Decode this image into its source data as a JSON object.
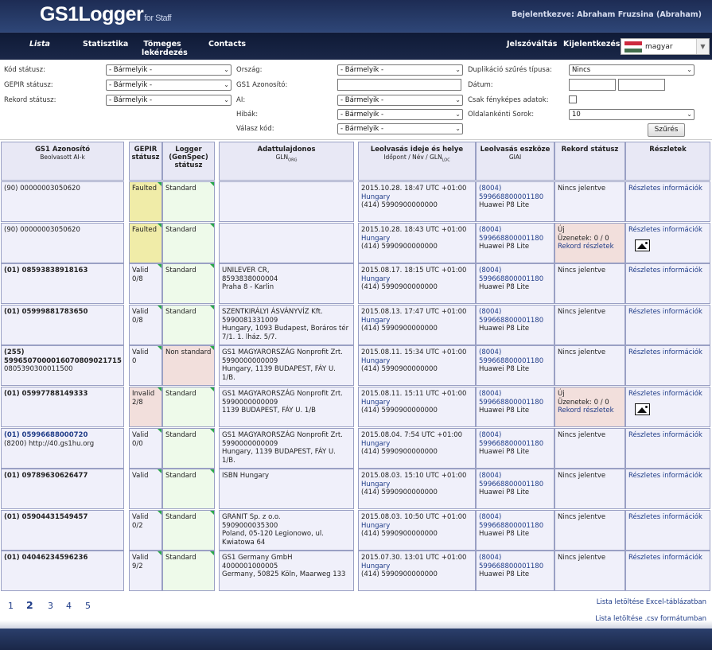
{
  "header": {
    "logo": "GS1Logger",
    "logo_sub": "for Staff",
    "login_info": "Bejelentkezve: Abraham Fruzsina (Abraham)"
  },
  "nav": {
    "lista": "Lista",
    "statisztika": "Statisztika",
    "tomeges": "Tömeges lekérdezés",
    "contacts": "Contacts",
    "jelszovaltas": "Jelszóváltás",
    "kijelentkezes": "Kijelentkezés",
    "language": "magyar"
  },
  "filters": {
    "kod_statusz_label": "Kód státusz:",
    "kod_statusz_value": "- Bármelyik -",
    "gepir_statusz_label": "GEPIR státusz:",
    "gepir_statusz_value": "- Bármelyik -",
    "rekord_statusz_label": "Rekord státusz:",
    "rekord_statusz_value": "- Bármelyik -",
    "orszag_label": "Ország:",
    "orszag_value": "- Bármelyik -",
    "gs1_azonosito_label": "GS1 Azonosító:",
    "ai_label": "AI:",
    "ai_value": "- Bármelyik -",
    "hibak_label": "Hibák:",
    "hibak_value": "- Bármelyik -",
    "valasz_kod_label": "Válasz kód:",
    "valasz_kod_value": "- Bármelyik -",
    "duplikacio_label": "Duplikáció szűrés típusa:",
    "duplikacio_value": "Nincs",
    "datum_label": "Dátum:",
    "csak_fenykepes_label": "Csak fényképes adatok:",
    "oldalankenti_label": "Oldalankénti Sorok:",
    "oldalankenti_value": "10",
    "szures_button": "Szűrés"
  },
  "table": {
    "headers": {
      "gs1": "GS1 Azonosító",
      "gs1_sub": "Beolvasott AI-k",
      "gepir": "GEPIR státusz",
      "logger": "Logger (GenSpec) státusz",
      "owner": "Adattulajdonos",
      "owner_sub": "GLN",
      "owner_sub_sub": "ORG",
      "scan": "Leolvasás ideje és helye",
      "scan_sub": "Időpont / Név / GLN",
      "scan_sub_sub": "LOC",
      "device": "Leolvasás eszköze",
      "device_sub": "GIAI",
      "record": "Rekord státusz",
      "details": "Részletek"
    },
    "rows": [
      {
        "id": "(90) 00000003050620",
        "id_extra": "",
        "bold": false,
        "link": false,
        "gepir": "Faulted",
        "gepir_extra": "",
        "gepir_cls": "faulted",
        "logger": "Standard",
        "logger_cls": "standard",
        "owner": [
          "",
          "",
          ""
        ],
        "scan": [
          "2015.10.28. 18:47 UTC +01:00",
          "Hungary",
          "(414) 5990900000000"
        ],
        "device": [
          "(8004)",
          "599668800001180",
          "Huawei P8 Lite"
        ],
        "record": [
          "Nincs jelentve",
          "",
          ""
        ],
        "record_new": false,
        "details": "Részletes információk",
        "has_image": false
      },
      {
        "id": "(90) 00000003050620",
        "id_extra": "",
        "bold": false,
        "link": false,
        "gepir": "Faulted",
        "gepir_extra": "",
        "gepir_cls": "faulted",
        "logger": "Standard",
        "logger_cls": "standard",
        "owner": [
          "",
          "",
          ""
        ],
        "scan": [
          "2015.10.28. 18:43 UTC +01:00",
          "Hungary",
          "(414) 5990900000000"
        ],
        "device": [
          "(8004)",
          "599668800001180",
          "Huawei P8 Lite"
        ],
        "record": [
          "Új",
          "Üzenetek: 0 / 0",
          "Rekord részletek"
        ],
        "record_new": true,
        "details": "Részletes információk",
        "has_image": true
      },
      {
        "id": "(01) 08593838918163",
        "id_extra": "",
        "bold": true,
        "link": false,
        "gepir": "Valid",
        "gepir_extra": "0/8",
        "gepir_cls": "",
        "logger": "Standard",
        "logger_cls": "standard",
        "owner": [
          "UNILEVER CR,",
          "8593838000004",
          "Praha 8 - Karlin"
        ],
        "scan": [
          "2015.08.17. 18:15 UTC +01:00",
          "Hungary",
          "(414) 5990900000000"
        ],
        "device": [
          "(8004)",
          "599668800001180",
          "Huawei P8 Lite"
        ],
        "record": [
          "Nincs jelentve",
          "",
          ""
        ],
        "record_new": false,
        "details": "Részletes információk",
        "has_image": false
      },
      {
        "id": "(01) 05999881783650",
        "id_extra": "",
        "bold": true,
        "link": false,
        "gepir": "Valid",
        "gepir_extra": "0/8",
        "gepir_cls": "",
        "logger": "Standard",
        "logger_cls": "standard",
        "owner": [
          "SZENTKIRÁLYI ÁSVÁNYVÍZ Kft.",
          "5990081331009",
          "Hungary, 1093 Budapest, Boráros tér 7/1. 1. lház. 5/7."
        ],
        "scan": [
          "2015.08.13. 17:47 UTC +01:00",
          "Hungary",
          "(414) 5990900000000"
        ],
        "device": [
          "(8004)",
          "599668800001180",
          "Huawei P8 Lite"
        ],
        "record": [
          "Nincs jelentve",
          "",
          ""
        ],
        "record_new": false,
        "details": "Részletes információk",
        "has_image": false
      },
      {
        "id": "(255) 5996507000016070809021715",
        "id_extra": "0805390300011500",
        "bold": true,
        "link": false,
        "gepir": "Valid",
        "gepir_extra": "0",
        "gepir_cls": "",
        "logger": "Non standard",
        "logger_cls": "nonstd",
        "owner": [
          "GS1 MAGYARORSZÁG Nonprofit Zrt.",
          "5990000000009",
          "Hungary, 1139 BUDAPEST, FÁY U. 1/B."
        ],
        "scan": [
          "2015.08.11. 15:34 UTC +01:00",
          "Hungary",
          "(414) 5990900000000"
        ],
        "device": [
          "(8004)",
          "599668800001180",
          "Huawei P8 Lite"
        ],
        "record": [
          "Nincs jelentve",
          "",
          ""
        ],
        "record_new": false,
        "details": "Részletes információk",
        "has_image": false
      },
      {
        "id": "(01) 05997788149333",
        "id_extra": "",
        "bold": true,
        "link": false,
        "gepir": "Invalid",
        "gepir_extra": "2/8",
        "gepir_cls": "invalid",
        "logger": "Standard",
        "logger_cls": "standard",
        "owner": [
          "GS1 MAGYARORSZÁG Nonprofit Zrt.",
          "5990000000009",
          "1139 BUDAPEST, FÁY U. 1/B"
        ],
        "scan": [
          "2015.08.11. 15:11 UTC +01:00",
          "Hungary",
          "(414) 5990900000000"
        ],
        "device": [
          "(8004)",
          "599668800001180",
          "Huawei P8 Lite"
        ],
        "record": [
          "Új",
          "Üzenetek: 0 / 0",
          "Rekord részletek"
        ],
        "record_new": true,
        "details": "Részletes információk",
        "has_image": true
      },
      {
        "id": "(01) 05996688000720",
        "id_extra": "(8200) http://40.gs1hu.org",
        "bold": true,
        "link": true,
        "gepir": "Valid",
        "gepir_extra": "0/0",
        "gepir_cls": "",
        "logger": "Standard",
        "logger_cls": "standard",
        "owner": [
          "GS1 MAGYARORSZÁG Nonprofit Zrt.",
          "5990000000009",
          "Hungary, 1139 BUDAPEST, FÁY U. 1/B."
        ],
        "scan": [
          "2015.08.04. 7:54 UTC +01:00",
          "Hungary",
          "(414) 5990900000000"
        ],
        "device": [
          "(8004)",
          "599668800001180",
          "Huawei P8 Lite"
        ],
        "record": [
          "Nincs jelentve",
          "",
          ""
        ],
        "record_new": false,
        "details": "Részletes információk",
        "has_image": false
      },
      {
        "id": "(01) 09789630626477",
        "id_extra": "",
        "bold": true,
        "link": false,
        "gepir": "Valid",
        "gepir_extra": "",
        "gepir_cls": "",
        "logger": "Standard",
        "logger_cls": "standard",
        "owner": [
          "ISBN Hungary",
          "",
          ""
        ],
        "scan": [
          "2015.08.03. 15:10 UTC +01:00",
          "Hungary",
          "(414) 5990900000000"
        ],
        "device": [
          "(8004)",
          "599668800001180",
          "Huawei P8 Lite"
        ],
        "record": [
          "Nincs jelentve",
          "",
          ""
        ],
        "record_new": false,
        "details": "Részletes információk",
        "has_image": false
      },
      {
        "id": "(01) 05904431549457",
        "id_extra": "",
        "bold": true,
        "link": false,
        "gepir": "Valid",
        "gepir_extra": "0/2",
        "gepir_cls": "",
        "logger": "Standard",
        "logger_cls": "standard",
        "owner": [
          "GRANIT Sp. z o.o.",
          "5909000035300",
          "Poland, 05-120 Legionowo, ul. Kwiatowa 64"
        ],
        "scan": [
          "2015.08.03. 10:50 UTC +01:00",
          "Hungary",
          "(414) 5990900000000"
        ],
        "device": [
          "(8004)",
          "599668800001180",
          "Huawei P8 Lite"
        ],
        "record": [
          "Nincs jelentve",
          "",
          ""
        ],
        "record_new": false,
        "details": "Részletes információk",
        "has_image": false
      },
      {
        "id": "(01) 04046234596236",
        "id_extra": "",
        "bold": true,
        "link": false,
        "gepir": "Valid",
        "gepir_extra": "9/2",
        "gepir_cls": "",
        "logger": "Standard",
        "logger_cls": "standard",
        "owner": [
          "GS1 Germany GmbH",
          "4000001000005",
          "Germany, 50825 Köln, Maarweg 133"
        ],
        "scan": [
          "2015.07.30. 13:01 UTC +01:00",
          "Hungary",
          "(414) 5990900000000"
        ],
        "device": [
          "(8004)",
          "599668800001180",
          "Huawei P8 Lite"
        ],
        "record": [
          "Nincs jelentve",
          "",
          ""
        ],
        "record_new": false,
        "details": "Részletes információk",
        "has_image": false
      }
    ]
  },
  "pagination": {
    "pages": [
      "1",
      "2",
      "3",
      "4",
      "5"
    ],
    "current": "2"
  },
  "downloads": {
    "excel": "Lista letöltése Excel-táblázatban",
    "csv": "Lista letöltése .csv formátumban"
  }
}
